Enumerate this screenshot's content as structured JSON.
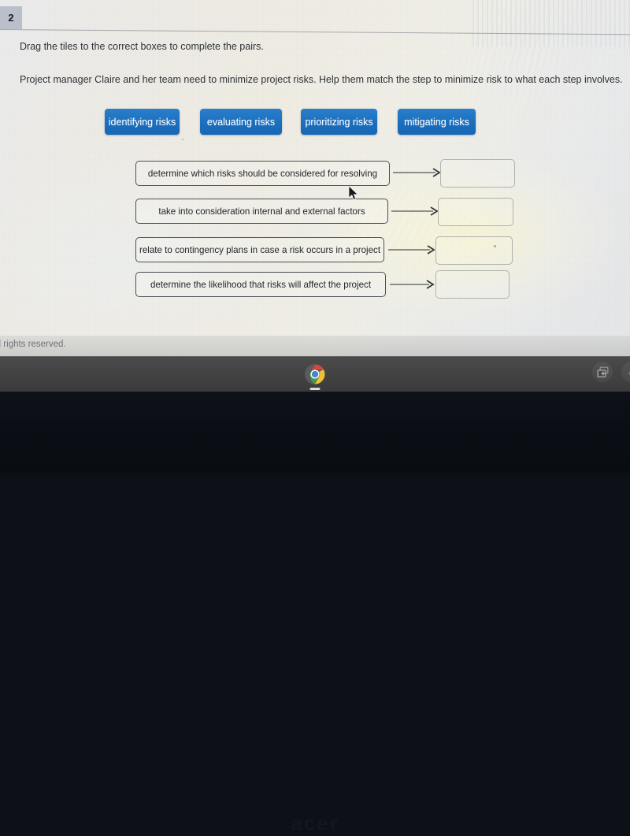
{
  "question": {
    "number": "2",
    "instruction_line1": "Drag the tiles to the correct boxes to complete the pairs.",
    "instruction_line2": "Project manager Claire and her team need to minimize project risks. Help them match the step to minimize risk to what each step involves."
  },
  "tiles": [
    {
      "label": "identifying risks"
    },
    {
      "label": "evaluating risks"
    },
    {
      "label": "prioritizing risks"
    },
    {
      "label": "mitigating risks"
    }
  ],
  "rows": [
    {
      "statement": "determine which risks should be considered for resolving",
      "drop_value": ""
    },
    {
      "statement": "take into consideration internal and external factors",
      "drop_value": ""
    },
    {
      "statement": "relate to contingency plans in case a risk occurs in a project",
      "drop_value": ""
    },
    {
      "statement": "determine the likelihood that risks will affect the project",
      "drop_value": ""
    }
  ],
  "footer": {
    "copyright": "ll rights reserved."
  },
  "shelf": {
    "chrome_label": "chrome-browser",
    "tray_overview_label": "overview-windows",
    "tray_second_label": "status-tray"
  },
  "bezel": {
    "brand": "acer"
  },
  "colors": {
    "tile_blue": "#1b6fbe",
    "tile_text": "#ffffff",
    "statement_border": "#4a4f56",
    "drop_border": "#aeb2ae",
    "page_text": "#2d3238",
    "shelf": "#434344"
  }
}
